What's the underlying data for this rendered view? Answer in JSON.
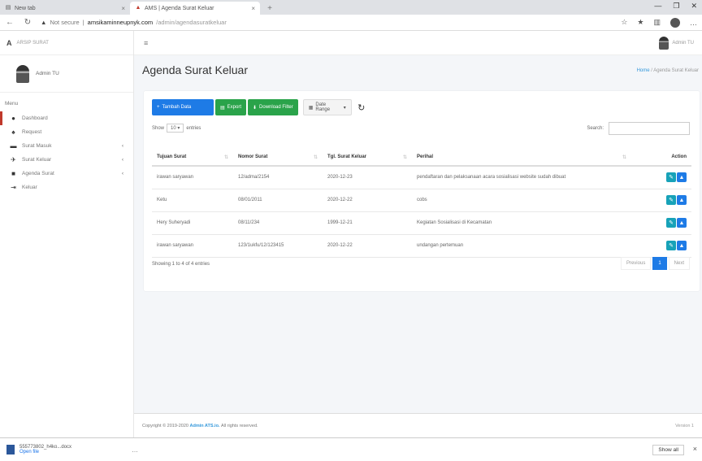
{
  "browser": {
    "tabs": [
      {
        "label": "New tab",
        "active": false
      },
      {
        "label": "AMS | Agenda Surat Keluar",
        "active": true
      }
    ],
    "url_security": "Not secure",
    "url_host": "amsikaminneupnyk.com",
    "url_path": "/admin/agendasuratkeluar"
  },
  "sidebar": {
    "brand": "ARSIP SURAT",
    "user_name": "Admin TU",
    "menu_header": "Menu",
    "items": [
      {
        "label": "Dashboard",
        "icon": "palette-icon",
        "active": true,
        "has_caret": false
      },
      {
        "label": "Request",
        "icon": "pin-icon",
        "active": false,
        "has_caret": false
      },
      {
        "label": "Surat Masuk",
        "icon": "inbox-icon",
        "active": false,
        "has_caret": true
      },
      {
        "label": "Surat Keluar",
        "icon": "send-icon",
        "active": false,
        "has_caret": true
      },
      {
        "label": "Agenda Surat",
        "icon": "book-icon",
        "active": false,
        "has_caret": true
      },
      {
        "label": "Keluar",
        "icon": "logout-icon",
        "active": false,
        "has_caret": false
      }
    ]
  },
  "topnav": {
    "user_name": "Admin TU"
  },
  "page": {
    "title": "Agenda Surat Keluar",
    "breadcrumb_home": "Home",
    "breadcrumb_current": "Agenda Surat Keluar"
  },
  "toolbar": {
    "add_label": "Tambah Data",
    "export_label": "Export",
    "download_label": "Download Filter",
    "date_range_label": "Date Range",
    "refresh_icon": "refresh-icon"
  },
  "table_controls": {
    "show_label": "Show",
    "entries_value": "10",
    "entries_label": "entries",
    "search_label": "Search:",
    "search_value": ""
  },
  "table": {
    "columns": [
      "Tujuan Surat",
      "Nomor Surat",
      "Tgl. Surat Keluar",
      "Perihal",
      "Action"
    ],
    "rows": [
      [
        "irawan saryawan",
        "12/adma/2154",
        "2020-12-23",
        "pendaftaran dan pelaksanaan acara sosialisasi website sudah dibuat"
      ],
      [
        "Ketu",
        "08/01/2011",
        "2020-12-22",
        "cobs"
      ],
      [
        "Hery Suheryadi",
        "08/11/234",
        "1999-12-21",
        "Kegiatan Sosialisasi di Kecamatan"
      ],
      [
        "irawan saryawan",
        "123/1ukfu/12/123415",
        "2020-12-22",
        "undangan pertemuan"
      ]
    ]
  },
  "pagination": {
    "info": "Showing 1 to 4 of 4 entries",
    "previous": "Previous",
    "current": "1",
    "next": "Next"
  },
  "footer": {
    "copyright": "Copyright © 2019-2020",
    "brand": "Admin ATS.io.",
    "rights": "All rights reserved.",
    "version": "Version 1"
  },
  "download_bar": {
    "file_name": "555773802_h4ko...docx",
    "file_sub": "Open file",
    "show_all": "Show all"
  }
}
